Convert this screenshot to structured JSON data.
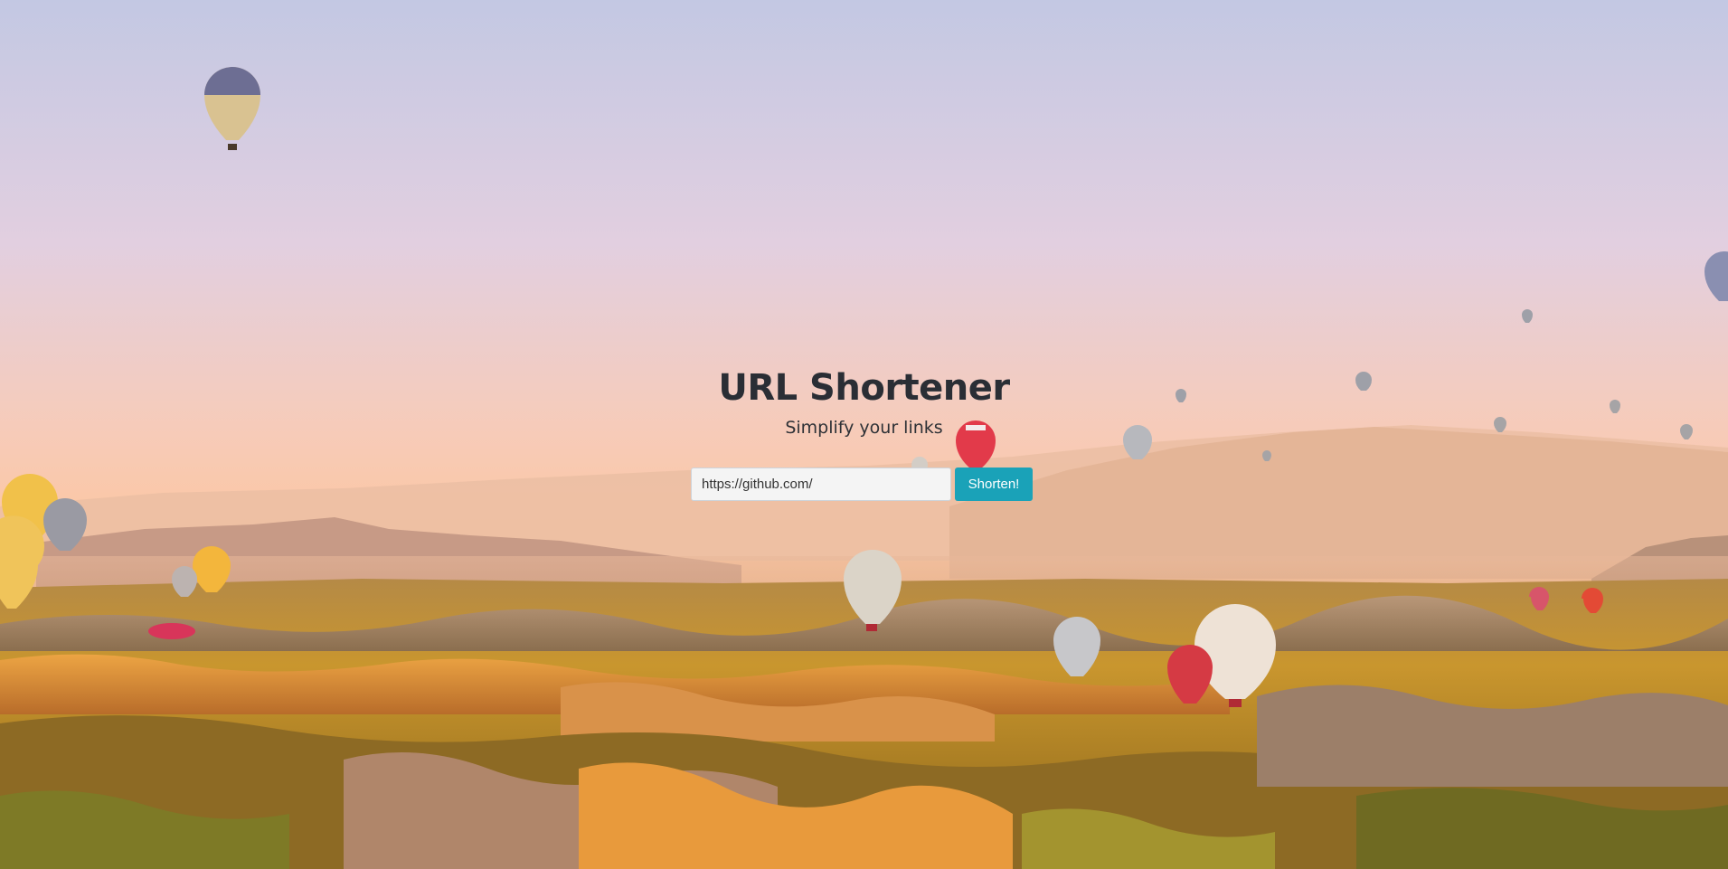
{
  "page": {
    "title": "URL Shortener",
    "subtitle": "Simplify your links"
  },
  "form": {
    "url_value": "https://github.com/",
    "submit_label": "Shorten!"
  },
  "background": {
    "description_icon": "hot-air-balloons-landscape",
    "colors": {
      "sky_top": "#c3c8e3",
      "sky_horizon": "#fbc7a4",
      "ground": "#b98c2e",
      "button": "#1aa2b8"
    }
  }
}
